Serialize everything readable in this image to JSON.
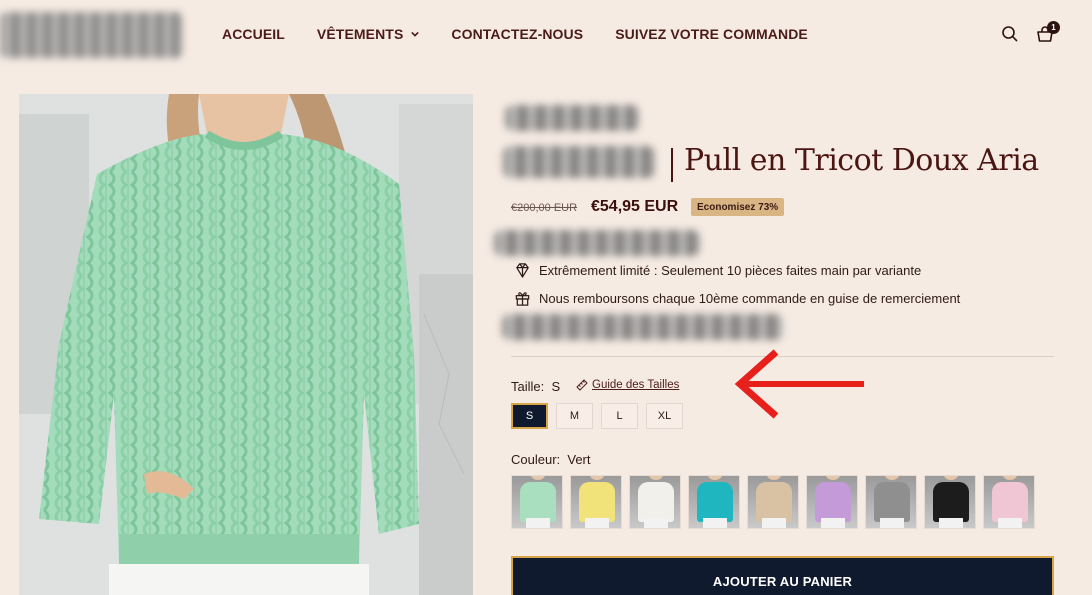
{
  "nav": {
    "items": [
      {
        "label": "ACCUEIL"
      },
      {
        "label": "VÊTEMENTS"
      },
      {
        "label": "CONTACTEZ-NOUS"
      },
      {
        "label": "SUIVEZ VOTRE COMMANDE"
      }
    ],
    "cart_count": "1"
  },
  "product": {
    "title": "Pull en Tricot Doux Aria",
    "old_price": "€200,00 EUR",
    "new_price": "€54,95 EUR",
    "save_badge": "Economisez 73%",
    "features": [
      {
        "icon": "diamond-icon",
        "text": "Extrêmement limité : Seulement 10 pièces faites main par variante"
      },
      {
        "icon": "gift-icon",
        "text": "Nous remboursons chaque 10ème commande en guise de remerciement"
      }
    ],
    "size_label": "Taille:",
    "size_value": "S",
    "size_guide": "Guide des Tailles",
    "sizes": [
      "S",
      "M",
      "L",
      "XL"
    ],
    "selected_size": "S",
    "color_label": "Couleur:",
    "color_value": "Vert",
    "colors": [
      {
        "name": "Vert",
        "hex": "#a9dfbf"
      },
      {
        "name": "Jaune",
        "hex": "#f1e27a"
      },
      {
        "name": "Blanc",
        "hex": "#f2f0ea"
      },
      {
        "name": "Turquoise",
        "hex": "#1fb6bf"
      },
      {
        "name": "Beige",
        "hex": "#d9c1a3"
      },
      {
        "name": "Violet",
        "hex": "#c49ad8"
      },
      {
        "name": "Gris",
        "hex": "#8f8f8f"
      },
      {
        "name": "Noir",
        "hex": "#1c1c1c"
      },
      {
        "name": "Rose",
        "hex": "#f0c6d4"
      }
    ],
    "add_to_cart": "AJOUTER AU PANIER"
  },
  "colors": {
    "background": "#f6ebe3",
    "brand": "#4b1c17",
    "button": "#0f1a2e",
    "button_border": "#d6a548",
    "badge": "#d8b583",
    "annotation_arrow": "#e8201c"
  }
}
